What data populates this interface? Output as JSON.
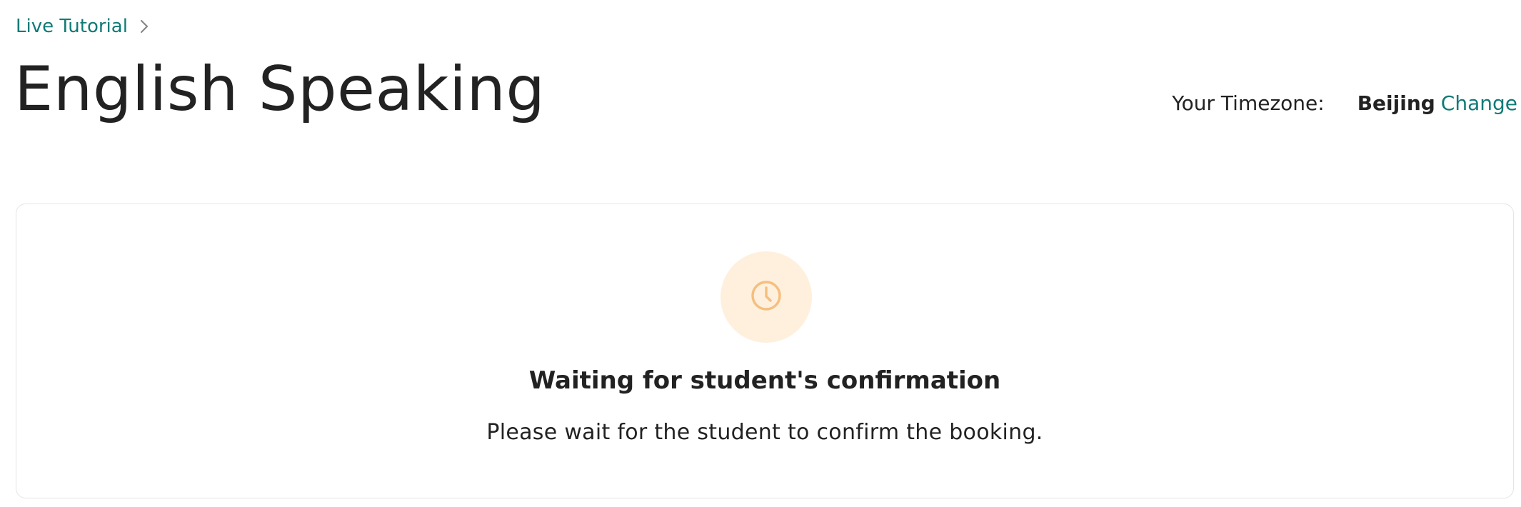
{
  "breadcrumb": {
    "link_label": "Live Tutorial",
    "separator_icon": "chevron-right-icon"
  },
  "page": {
    "title": "English Speaking"
  },
  "timezone": {
    "label": "Your Timezone:",
    "value": "Beijing",
    "change_label": "Change"
  },
  "status_card": {
    "icon": "clock-icon",
    "title": "Waiting for student's confirmation",
    "message": "Please wait for the student to confirm the booking."
  },
  "colors": {
    "link_teal": "#0f7b76",
    "status_icon_bg": "#fff0dd",
    "status_icon_fg": "#f5bf7e",
    "card_border": "#e4e4e4",
    "text": "#222222"
  }
}
